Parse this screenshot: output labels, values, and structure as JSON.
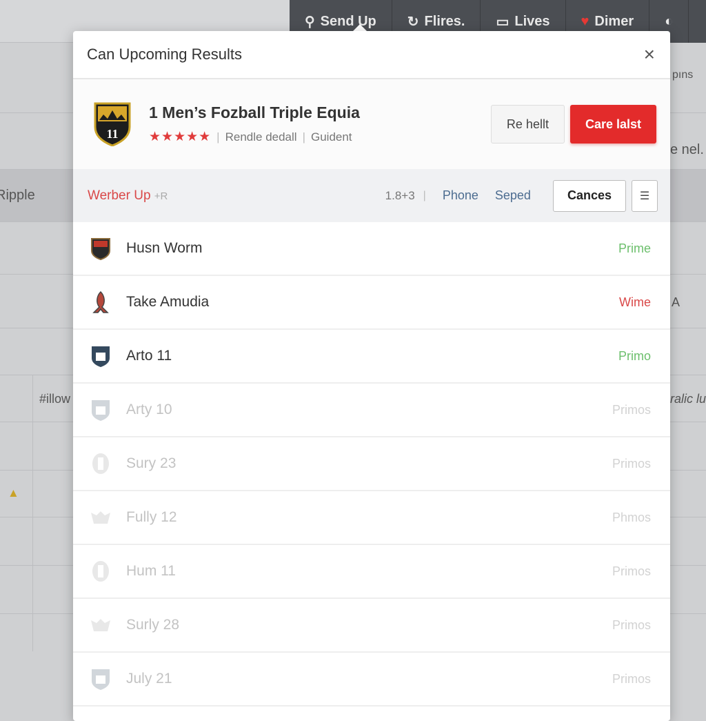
{
  "nav": {
    "tabs": [
      {
        "label": "Send Up",
        "icon": "pin-icon"
      },
      {
        "label": "Flires.",
        "icon": "refresh-icon"
      },
      {
        "label": "Lives",
        "icon": "monitor-icon"
      },
      {
        "label": "Dimer",
        "icon": "heart-icon"
      }
    ]
  },
  "background": {
    "texts": [
      "pıns",
      "e nel.",
      "Ripple",
      "A",
      "#illow",
      "ralic lu"
    ]
  },
  "modal": {
    "title": "Can Upcoming Results",
    "close": "×",
    "card": {
      "crest_text": "11",
      "title": "1 Men’s Fozball Triple Equia",
      "rating": 4.5,
      "stars": "★★★★★",
      "meta1": "Rendle dedall",
      "meta2": "Guident",
      "secondary_button": "Re hellt",
      "primary_button": "Care lalst"
    },
    "filter": {
      "label": "Werber Up",
      "label_suffix": "+R",
      "count": "1.8+3",
      "link1": "Phone",
      "link2": "Seped",
      "button": "Cances",
      "menu_icon": "filter-icon"
    },
    "rows": [
      {
        "name": "Husn Worm",
        "status": "Prime",
        "color": "#6cbf6c",
        "icon": "crest-icon"
      },
      {
        "name": "Take Amudia",
        "status": "Wime",
        "color": "#d94848",
        "icon": "ribbon-icon"
      },
      {
        "name": "Arto 11",
        "status": "Primo",
        "color": "#6cbf6c",
        "icon": "shield-icon"
      },
      {
        "name": "Arty 10",
        "status": "Primos",
        "icon": "shield-icon"
      },
      {
        "name": "Sury 23",
        "status": "Primos",
        "icon": "badge-icon"
      },
      {
        "name": "Fully 12",
        "status": "Phmos",
        "icon": "wings-icon"
      },
      {
        "name": "Hum 11",
        "status": "Primos",
        "icon": "badge-icon"
      },
      {
        "name": "Surly 28",
        "status": "Primos",
        "icon": "wings-icon"
      },
      {
        "name": "July 21",
        "status": "Primos",
        "icon": "shield-icon"
      }
    ]
  },
  "colors": {
    "accent": "#e32b2b",
    "nav": "#4b4e53",
    "link": "#4c6c90"
  }
}
